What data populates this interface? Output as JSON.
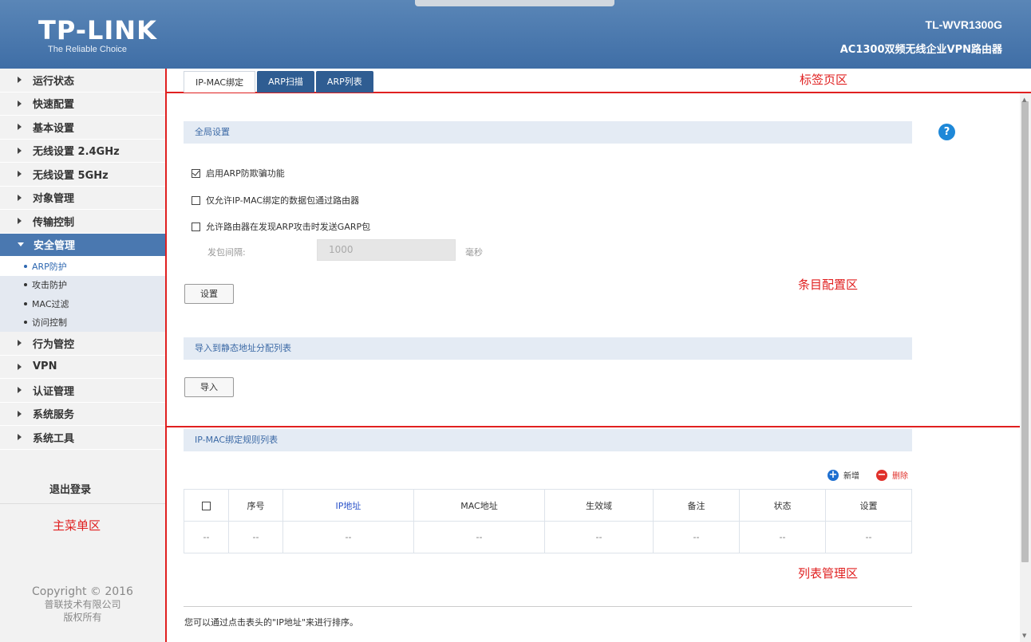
{
  "header": {
    "logo": "TP-LINK",
    "tagline": "The Reliable Choice",
    "model": "TL-WVR1300G",
    "model_desc": "AC1300双频无线企业VPN路由器"
  },
  "sidebar": {
    "items": [
      {
        "label": "运行状态"
      },
      {
        "label": "快速配置"
      },
      {
        "label": "基本设置"
      },
      {
        "label": "无线设置 2.4GHz"
      },
      {
        "label": "无线设置 5GHz"
      },
      {
        "label": "对象管理"
      },
      {
        "label": "传输控制"
      },
      {
        "label": "安全管理"
      },
      {
        "label": "行为管控"
      },
      {
        "label": "VPN"
      },
      {
        "label": "认证管理"
      },
      {
        "label": "系统服务"
      },
      {
        "label": "系统工具"
      }
    ],
    "sub_items": [
      {
        "label": "ARP防护"
      },
      {
        "label": "攻击防护"
      },
      {
        "label": "MAC过滤"
      },
      {
        "label": "访问控制"
      }
    ],
    "logout": "退出登录",
    "copyright_line1": "Copyright © 2016",
    "copyright_line2": "普联技术有限公司",
    "copyright_line3": "版权所有"
  },
  "annotations": {
    "tabs_area": "标签页区",
    "config_area": "条目配置区",
    "main_menu": "主菜单区",
    "list_area": "列表管理区"
  },
  "tabs": [
    {
      "label": "IP-MAC绑定"
    },
    {
      "label": "ARP扫描"
    },
    {
      "label": "ARP列表"
    }
  ],
  "global": {
    "section_title": "全局设置",
    "opt_enable_arp": "启用ARP防欺骗功能",
    "opt_enable_arp_checked": true,
    "opt_only_bound": "仅允许IP-MAC绑定的数据包通过路由器",
    "opt_garp": "允许路由器在发现ARP攻击时发送GARP包",
    "interval_label": "发包间隔:",
    "interval_value": "1000",
    "interval_unit": "毫秒",
    "set_button": "设置"
  },
  "import": {
    "section_title": "导入到静态地址分配列表",
    "import_button": "导入"
  },
  "rules": {
    "section_title": "IP-MAC绑定规则列表",
    "add_label": "新增",
    "delete_label": "删除",
    "columns": [
      "序号",
      "IP地址",
      "MAC地址",
      "生效域",
      "备注",
      "状态",
      "设置"
    ],
    "empty_row": [
      "--",
      "--",
      "--",
      "--",
      "--",
      "--",
      "--",
      "--"
    ]
  },
  "footer_note": "您可以通过点击表头的\"IP地址\"来进行排序。",
  "colors": {
    "header_bg": "#4a78b0",
    "annotation": "#e02020",
    "accent_link": "#2a52c9",
    "add_icon": "#1e6fd0",
    "delete_icon": "#e0302a"
  }
}
